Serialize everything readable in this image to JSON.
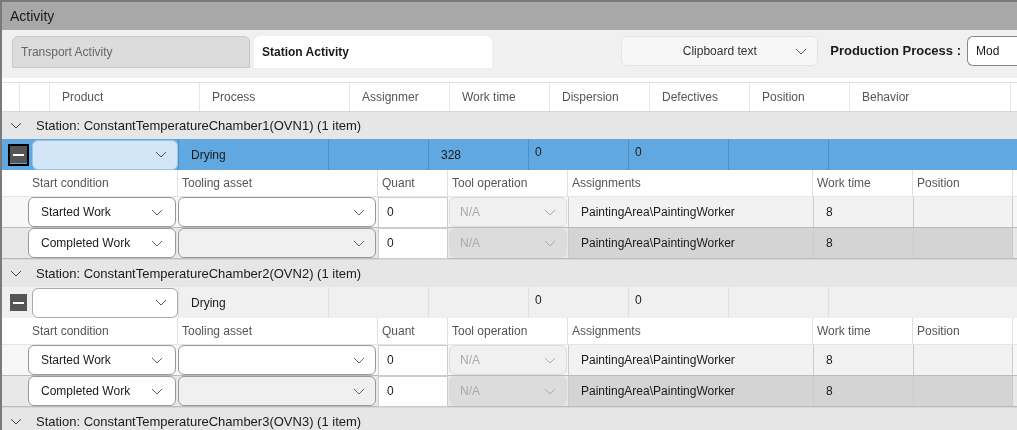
{
  "window": {
    "title": "Activity"
  },
  "tabs": [
    {
      "label": "Transport Activity",
      "selected": false
    },
    {
      "label": "Station Activity",
      "selected": true
    }
  ],
  "clipboard_dropdown": {
    "value": "Clipboard text"
  },
  "production_process": {
    "label": "Production Process :",
    "value": "Mod"
  },
  "table": {
    "columns": [
      "Product",
      "Process",
      "Assignmer",
      "Work time",
      "Dispersion",
      "Defectives",
      "Position",
      "Behavior"
    ],
    "groups": [
      {
        "header": "Station: ConstantTemperatureChamber1(OVN1) (1 item)",
        "expanded": true,
        "rows": [
          {
            "selected": true,
            "expanded": true,
            "process": "Drying",
            "work_time": "328",
            "dispersion": "0",
            "defectives": "0",
            "detail_columns": [
              "Start condition",
              "Tooling asset",
              "Quant",
              "Tool operation",
              "Assignments",
              "Work time",
              "Position"
            ],
            "details": [
              {
                "start_condition": "Started Work",
                "quant": "0",
                "tool_operation": "N/A",
                "assignments": "PaintingArea\\PaintingWorker",
                "work_time": "8",
                "selected": false
              },
              {
                "start_condition": "Completed Work",
                "quant": "0",
                "tool_operation": "N/A",
                "assignments": "PaintingArea\\PaintingWorker",
                "work_time": "8",
                "selected": true
              }
            ]
          }
        ]
      },
      {
        "header": "Station: ConstantTemperatureChamber2(OVN2) (1 item)",
        "expanded": true,
        "rows": [
          {
            "selected": false,
            "expanded": true,
            "process": "Drying",
            "dispersion": "0",
            "defectives": "0",
            "detail_columns": [
              "Start condition",
              "Tooling asset",
              "Quant",
              "Tool operation",
              "Assignments",
              "Work time",
              "Position"
            ],
            "details": [
              {
                "start_condition": "Started Work",
                "quant": "0",
                "tool_operation": "N/A",
                "assignments": "PaintingArea\\PaintingWorker",
                "work_time": "8",
                "selected": false
              },
              {
                "start_condition": "Completed Work",
                "quant": "0",
                "tool_operation": "N/A",
                "assignments": "PaintingArea\\PaintingWorker",
                "work_time": "8",
                "selected": true
              }
            ]
          }
        ]
      },
      {
        "header": "Station: ConstantTemperatureChamber3(OVN3) (1 item)",
        "expanded": true
      }
    ]
  }
}
